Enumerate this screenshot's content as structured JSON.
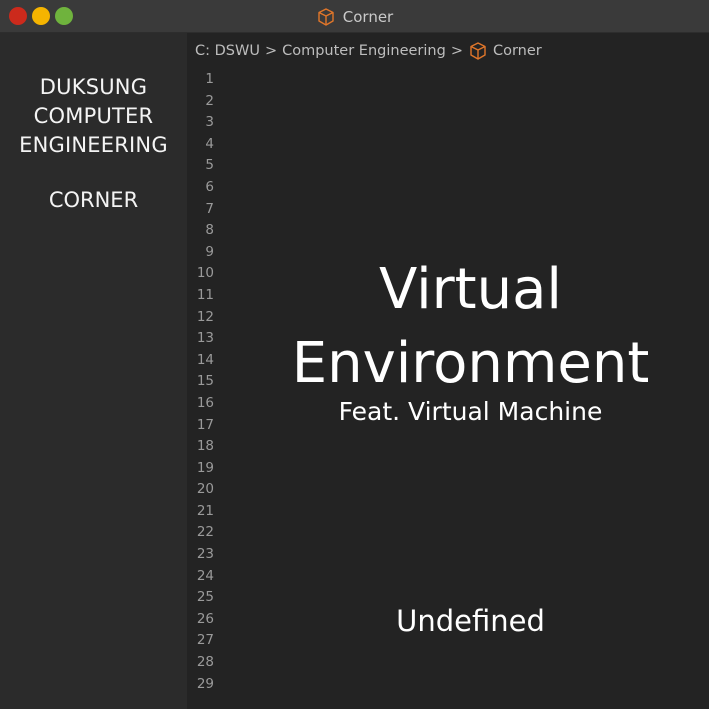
{
  "window": {
    "title": "Corner",
    "icon": "cube-icon",
    "controls": [
      "close",
      "minimize",
      "maximize"
    ],
    "colors": {
      "close": "#cc2a1c",
      "minimize": "#f5b400",
      "maximize": "#6fb33d",
      "accent": "#e0762a"
    }
  },
  "sidebar": {
    "heading_line1": "DUKSUNG",
    "heading_line2": "COMPUTER",
    "heading_line3": "ENGINEERING",
    "subheading": "CORNER"
  },
  "breadcrumb": {
    "root": "C: DSWU",
    "separator": ">",
    "folder": "Computer Engineering",
    "file": "Corner"
  },
  "editor": {
    "line_numbers": [
      "1",
      "2",
      "3",
      "4",
      "5",
      "6",
      "7",
      "8",
      "9",
      "10",
      "11",
      "12",
      "13",
      "14",
      "15",
      "16",
      "17",
      "18",
      "19",
      "20",
      "21",
      "22",
      "23",
      "24",
      "25",
      "26",
      "27",
      "28",
      "29"
    ],
    "title_line1": "Virtual",
    "title_line2": "Environment",
    "subtitle": "Feat. Virtual Machine",
    "footer": "Undefined"
  }
}
